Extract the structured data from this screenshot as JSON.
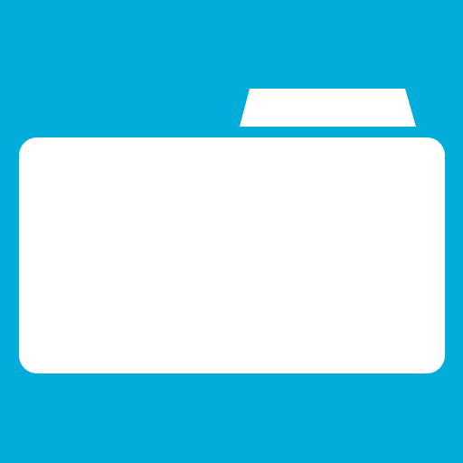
{
  "icon": {
    "name": "folder-icon",
    "background_color": "#02ADDB",
    "foreground_color": "#FFFFFF"
  }
}
